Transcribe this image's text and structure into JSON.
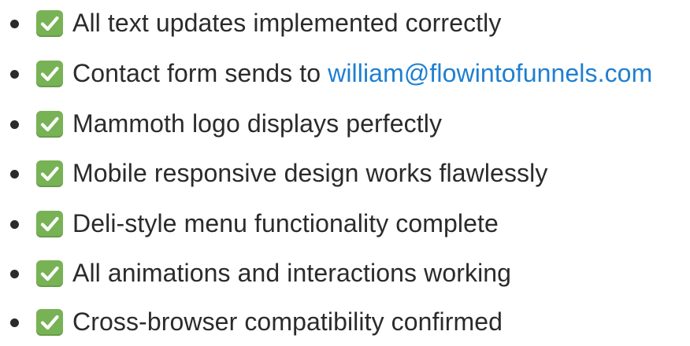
{
  "checklist": {
    "items": [
      {
        "text": "All text updates implemented correctly",
        "link": ""
      },
      {
        "text": "Contact form sends to ",
        "link": "william@flowintofunnels.com"
      },
      {
        "text": "Mammoth logo displays perfectly",
        "link": ""
      },
      {
        "text": "Mobile responsive design works flawlessly",
        "link": ""
      },
      {
        "text": "Deli-style menu functionality complete",
        "link": ""
      },
      {
        "text": "All animations and interactions working",
        "link": ""
      },
      {
        "text": "Cross-browser compatibility confirmed",
        "link": ""
      }
    ],
    "icon": "check-mark-button-icon",
    "check_color": "#77b255",
    "link_color": "#1f7fd1",
    "text_color": "#2b2b2b"
  }
}
